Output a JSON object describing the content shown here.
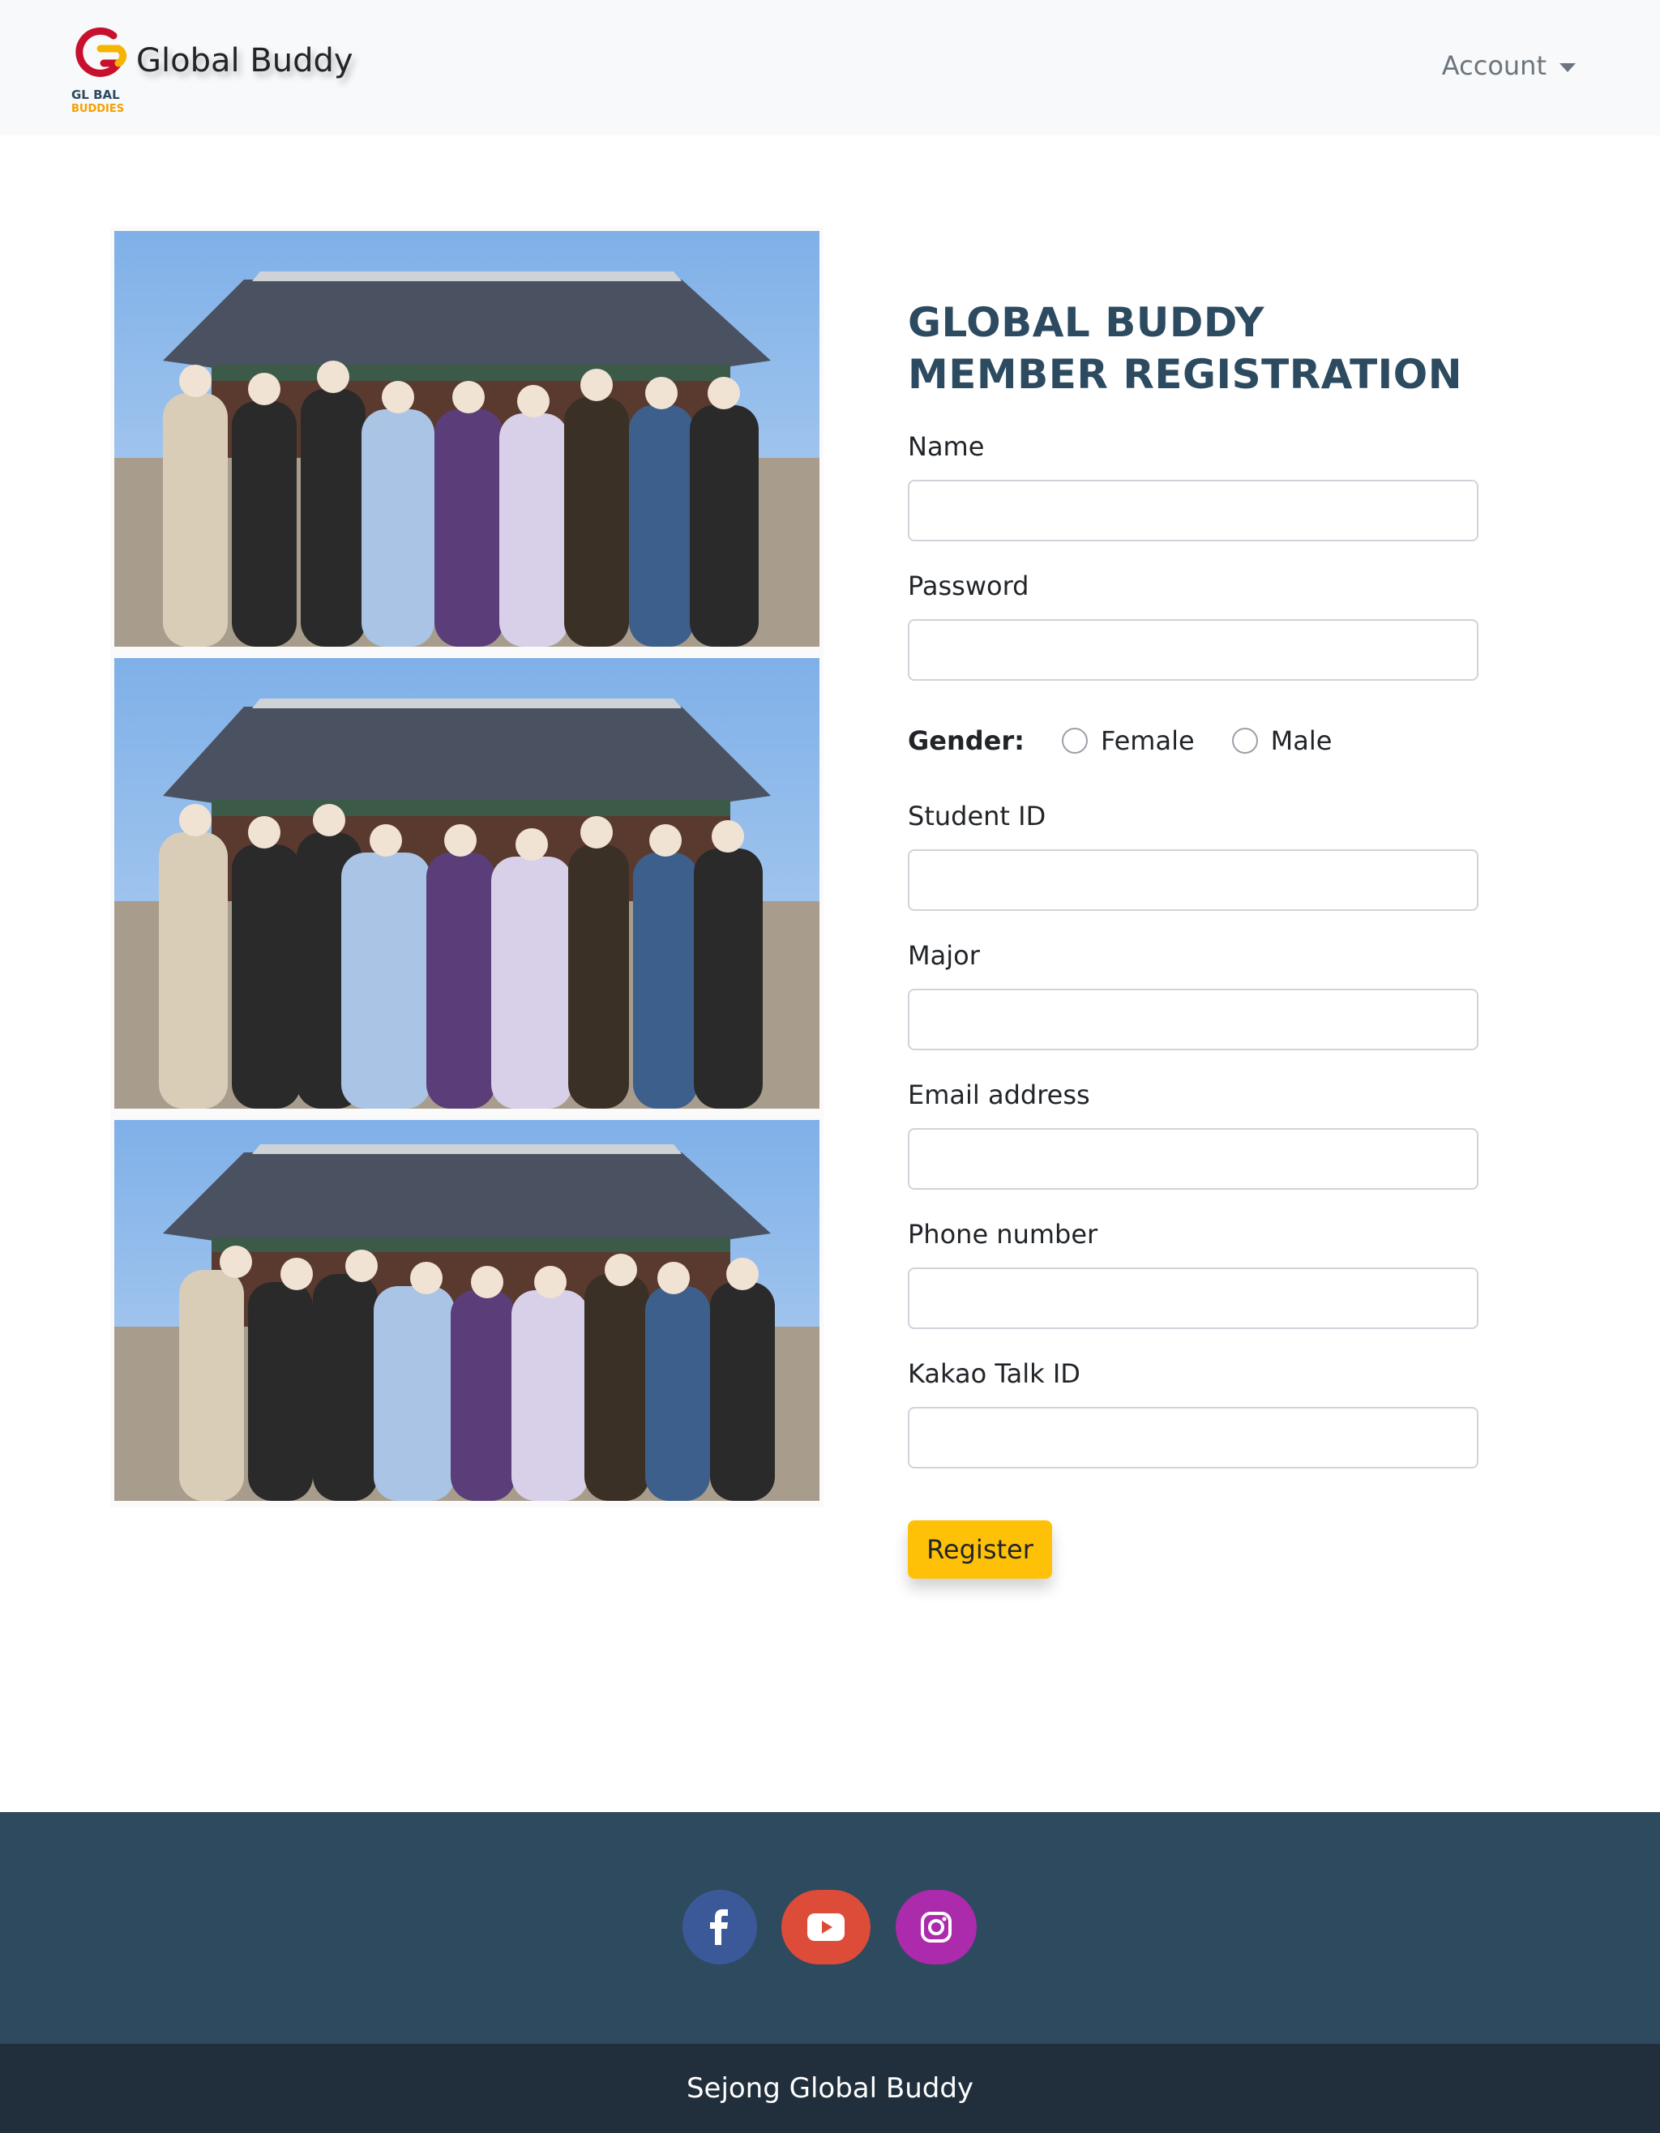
{
  "navbar": {
    "logo_text_line1": "GL BAL",
    "logo_text_line2": "BUDDIES",
    "brand": "Global Buddy",
    "account_label": "Account"
  },
  "photos": [
    {
      "description_icon": "group-photo"
    },
    {
      "description_icon": "group-photo"
    },
    {
      "description_icon": "group-photo"
    }
  ],
  "form": {
    "title": "GLOBAL BUDDY MEMBER REGISTRATION",
    "name_label": "Name",
    "password_label": "Password",
    "gender_label": "Gender:",
    "gender_options": [
      "Female",
      "Male"
    ],
    "student_id_label": "Student ID",
    "major_label": "Major",
    "email_label": "Email address",
    "phone_label": "Phone number",
    "kakao_label": "Kakao Talk ID",
    "register_label": "Register"
  },
  "footer": {
    "social": [
      {
        "name": "facebook-icon",
        "color": "#3b5998"
      },
      {
        "name": "youtube-icon",
        "color": "#dd4b39"
      },
      {
        "name": "instagram-icon",
        "color": "#ac2bac"
      }
    ],
    "bottom_text": "Sejong Global Buddy"
  },
  "colors": {
    "navbar_bg": "#f8f9fa",
    "title": "#2c4a60",
    "button": "#ffc107",
    "footer_bg": "#2e4a5f",
    "bottom_bar_bg": "#212e3c"
  }
}
